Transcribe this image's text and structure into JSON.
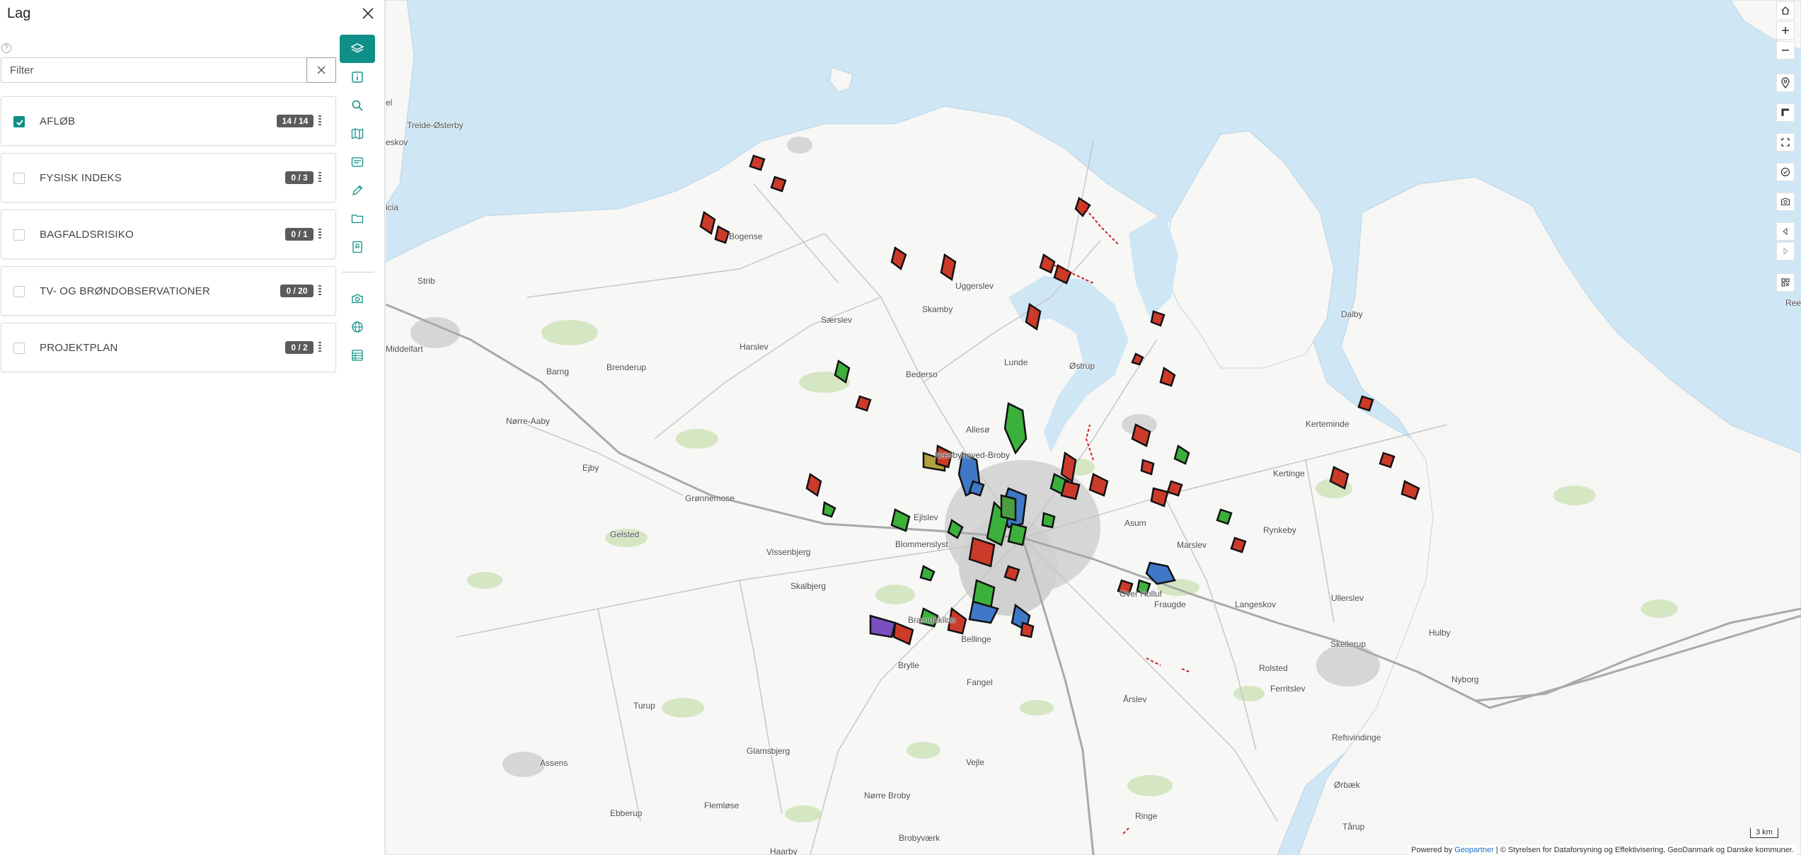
{
  "panel": {
    "title": "Lag",
    "help_glyph": "?",
    "filter": {
      "placeholder": "Filter",
      "value": ""
    },
    "layers": [
      {
        "label": "AFLØB",
        "count": "14 / 14",
        "checked": true
      },
      {
        "label": "FYSISK INDEKS",
        "count": "0 / 3",
        "checked": false
      },
      {
        "label": "BAGFALDSRISIKO",
        "count": "0 / 1",
        "checked": false
      },
      {
        "label": "TV- OG BRØNDOBSERVATIONER",
        "count": "0 / 20",
        "checked": false
      },
      {
        "label": "PROJEKTPLAN",
        "count": "0 / 2",
        "checked": false
      }
    ]
  },
  "toolbar": {
    "tools": [
      "layers-icon",
      "info-icon",
      "search-icon",
      "map-icon",
      "legend-icon",
      "edit-icon",
      "folder-icon",
      "bookmark-icon",
      "camera-icon",
      "globe-icon",
      "table-icon"
    ]
  },
  "map": {
    "places": [
      {
        "name": "Treide-Østerby"
      },
      {
        "name": "eskov"
      },
      {
        "name": "el"
      },
      {
        "name": "icia"
      },
      {
        "name": "Strib"
      },
      {
        "name": "Middelfart"
      },
      {
        "name": "Bogense"
      },
      {
        "name": "Uggerslev"
      },
      {
        "name": "Skamby"
      },
      {
        "name": "Særslev"
      },
      {
        "name": "Harslev"
      },
      {
        "name": "Brenderup"
      },
      {
        "name": "Barng"
      },
      {
        "name": "Lunde"
      },
      {
        "name": "Østrup"
      },
      {
        "name": "Dalby"
      },
      {
        "name": "Bederso"
      },
      {
        "name": "Nørre-Aaby"
      },
      {
        "name": "Ejby"
      },
      {
        "name": "Allesø"
      },
      {
        "name": "Næsbyhoved-Broby"
      },
      {
        "name": "Kerteminde"
      },
      {
        "name": "Kertinge"
      },
      {
        "name": "Grønnemose"
      },
      {
        "name": "Gelsted"
      },
      {
        "name": "Ejlslev"
      },
      {
        "name": "Blommenslyst"
      },
      {
        "name": "Vissenbjerg"
      },
      {
        "name": "Asum"
      },
      {
        "name": "Marslev"
      },
      {
        "name": "Rynkeby"
      },
      {
        "name": "Skalbjerg"
      },
      {
        "name": "Brændekilde"
      },
      {
        "name": "Over Holluf"
      },
      {
        "name": "Fraugde"
      },
      {
        "name": "Langeskov"
      },
      {
        "name": "Ullerslev"
      },
      {
        "name": "Hulby"
      },
      {
        "name": "Bellinge"
      },
      {
        "name": "Brylle"
      },
      {
        "name": "Skellerup"
      },
      {
        "name": "Fangel"
      },
      {
        "name": "Rolsted"
      },
      {
        "name": "Turup"
      },
      {
        "name": "Ferritslev"
      },
      {
        "name": "Nyborg"
      },
      {
        "name": "Årslev"
      },
      {
        "name": "Refsvindinge"
      },
      {
        "name": "Assens"
      },
      {
        "name": "Glamsbjerg"
      },
      {
        "name": "Vejle"
      },
      {
        "name": "Ørbæk"
      },
      {
        "name": "Nørre Broby"
      },
      {
        "name": "Flemløse"
      },
      {
        "name": "Ringe"
      },
      {
        "name": "Ebberup"
      },
      {
        "name": "Brobyværk"
      },
      {
        "name": "Tårup"
      },
      {
        "name": "Haarby"
      },
      {
        "name": "Ree"
      }
    ],
    "scale": "3 km",
    "attribution_prefix": "Powered by",
    "attribution_link": "Geopartner",
    "attribution_rest": "| © Styrelsen for Dataforsyning og Effektivisering, GeoDanmark og Danske kommuner.",
    "controls": [
      "home-icon",
      "zoom-in-icon",
      "zoom-out-icon",
      "location-icon",
      "measure-icon",
      "fullscreen-icon",
      "check-icon",
      "screenshot-icon",
      "back-icon",
      "forward-icon",
      "qr-icon"
    ],
    "colors": {
      "sea": "#cfe6f5",
      "land": "#f7f7f6",
      "urban": "#d6d6d6",
      "forest": "#d5e6c3",
      "accent": "#0e8f87"
    }
  }
}
